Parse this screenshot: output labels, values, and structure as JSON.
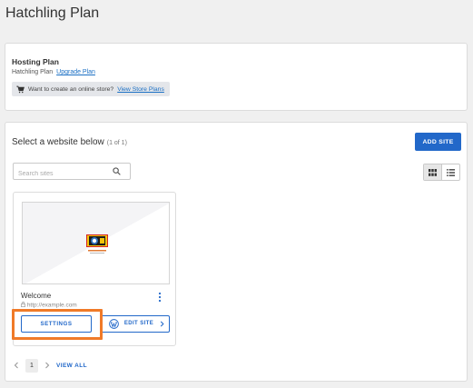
{
  "page": {
    "title": "Hatchling Plan"
  },
  "hosting": {
    "heading": "Hosting Plan",
    "plan_name": "Hatchling Plan",
    "upgrade_link": "Upgrade Plan",
    "store_prompt": "Want to create an online store?",
    "store_link": "View Store Plans",
    "cart_icon": "cart-icon"
  },
  "sites": {
    "heading": "Select a website below",
    "count": "(1 of 1)",
    "add_site_label": "ADD SITE",
    "search_placeholder": "Search sites",
    "search_value": "",
    "view_modes": [
      "grid-icon",
      "list-icon"
    ],
    "active_view": "grid",
    "items": [
      {
        "name": "Welcome",
        "url": "http://example.com",
        "settings_label": "SETTINGS",
        "edit_label": "EDIT SITE"
      }
    ],
    "pagination": {
      "current_page": "1",
      "view_all_label": "VIEW ALL"
    }
  },
  "colors": {
    "primary": "#2268c9",
    "highlight": "#f07a28",
    "background": "#f0f0f0"
  }
}
